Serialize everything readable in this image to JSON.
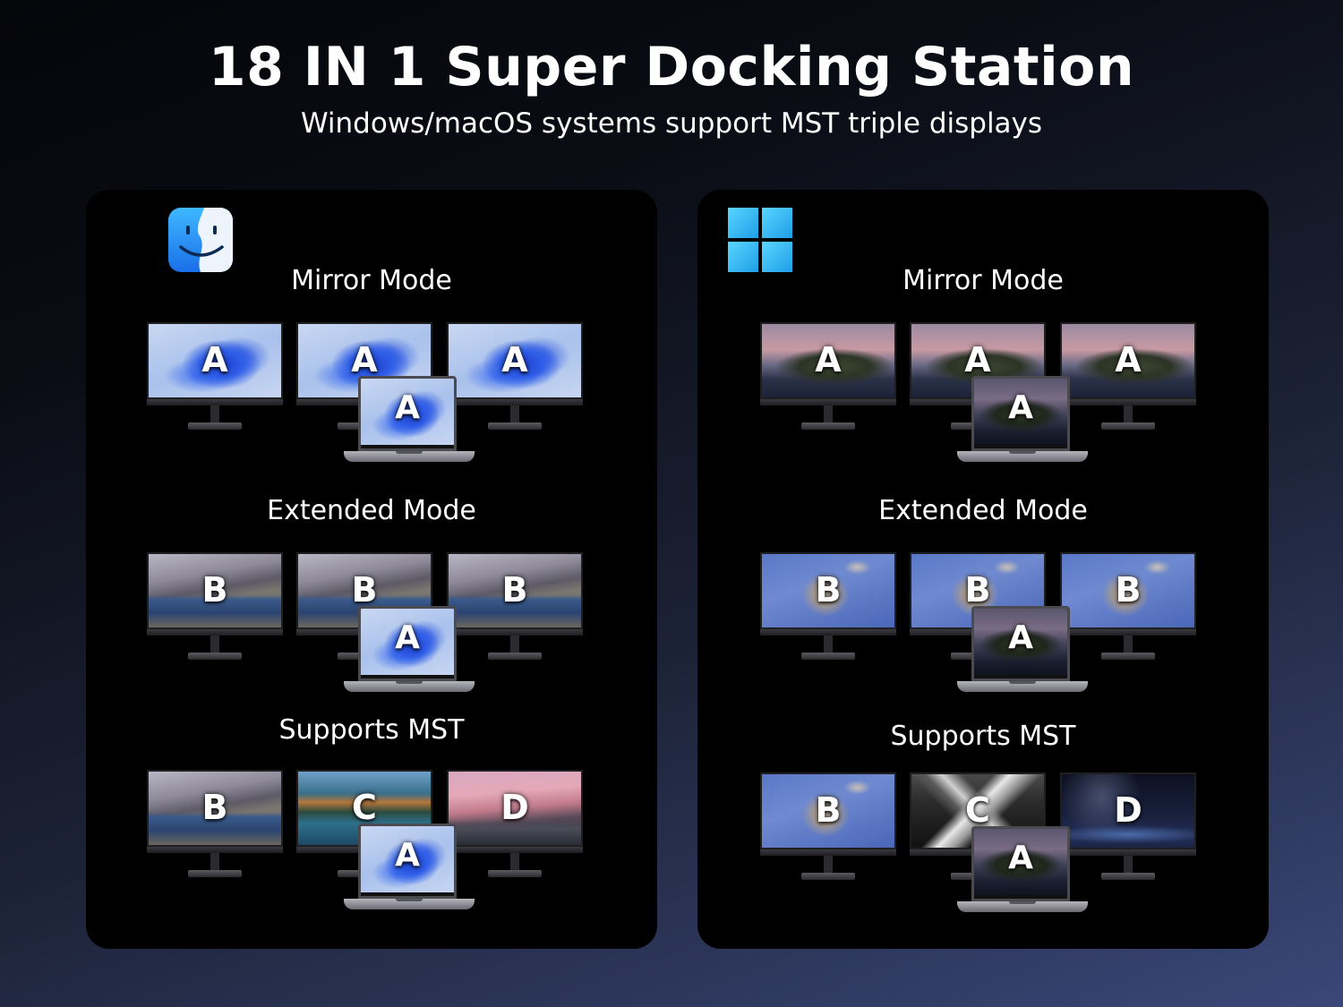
{
  "header": {
    "title": "18 IN 1 Super Docking Station",
    "subtitle": "Windows/macOS systems support MST triple displays"
  },
  "panels": [
    {
      "logo": "macos-finder-icon",
      "modes": [
        {
          "title": "Mirror Mode",
          "monitors": [
            "A",
            "A",
            "A"
          ],
          "laptop": "A"
        },
        {
          "title": "Extended Mode",
          "monitors": [
            "B",
            "B",
            "B"
          ],
          "laptop": "A"
        },
        {
          "title": "Supports MST",
          "monitors": [
            "B",
            "C",
            "D"
          ],
          "laptop": "A"
        }
      ]
    },
    {
      "logo": "windows-logo-icon",
      "modes": [
        {
          "title": "Mirror Mode",
          "monitors": [
            "A",
            "A",
            "A"
          ],
          "laptop": "A"
        },
        {
          "title": "Extended Mode",
          "monitors": [
            "B",
            "B",
            "B"
          ],
          "laptop": "A"
        },
        {
          "title": "Supports MST",
          "monitors": [
            "B",
            "C",
            "D"
          ],
          "laptop": "A"
        }
      ]
    }
  ],
  "colors": {
    "panel_background": "#000000",
    "windows_logo_blue": "#29b6f6",
    "finder_blue": "#1e8cf0"
  }
}
